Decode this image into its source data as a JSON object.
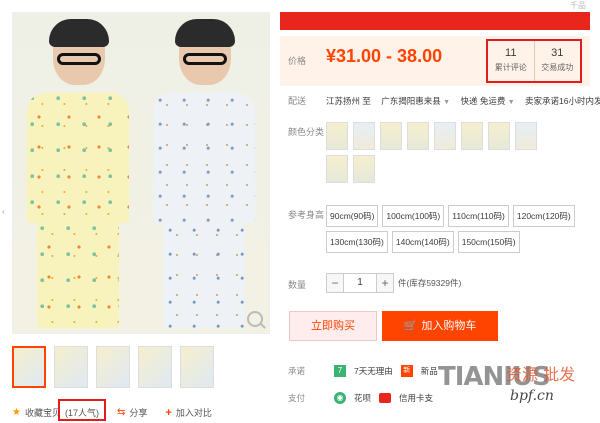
{
  "header": {
    "corner_text": "千品"
  },
  "price": {
    "label": "价格",
    "value": "¥31.00 - 38.00"
  },
  "stats": {
    "reviews_count": "11",
    "reviews_label": "累计评论",
    "sales_count": "31",
    "sales_label": "交易成功"
  },
  "shipping": {
    "label": "配送",
    "origin": "江苏扬州 至",
    "destination": "广东揭阳惠来县",
    "method": "快递 免运费",
    "promise": "卖家承诺16小时内发货"
  },
  "color": {
    "label": "颜色分类",
    "swatch_count": 10
  },
  "size": {
    "label": "参考身高",
    "options": [
      "90cm(90码)",
      "100cm(100码)",
      "110cm(110码)",
      "120cm(120码)",
      "130cm(130码)",
      "140cm(140码)",
      "150cm(150码)"
    ]
  },
  "quantity": {
    "label": "数量",
    "minus": "−",
    "value": "1",
    "plus": "+",
    "stock": "件(库存59329件)"
  },
  "buttons": {
    "buy_now": "立即购买",
    "add_cart": "加入购物车"
  },
  "promise": {
    "label": "承诺",
    "badge": "7",
    "text": "7天无理由",
    "new_badge": "新",
    "new_text": "新品"
  },
  "payment": {
    "label": "支付",
    "huabei": "花呗",
    "card": "信用卡支"
  },
  "gallery": {
    "thumb_count": 5
  },
  "actions": {
    "favorite": "收藏宝贝",
    "popularity": "(17人气)",
    "share": "分享",
    "compare": "加入对比"
  },
  "watermark": {
    "text": "TIANIUS",
    "cn": "资源 批发",
    "url": "bpf.cn"
  },
  "colors": {
    "accent": "#ff4400",
    "highlight_box": "#e31b1b",
    "price_bg": "#fff2e8"
  }
}
